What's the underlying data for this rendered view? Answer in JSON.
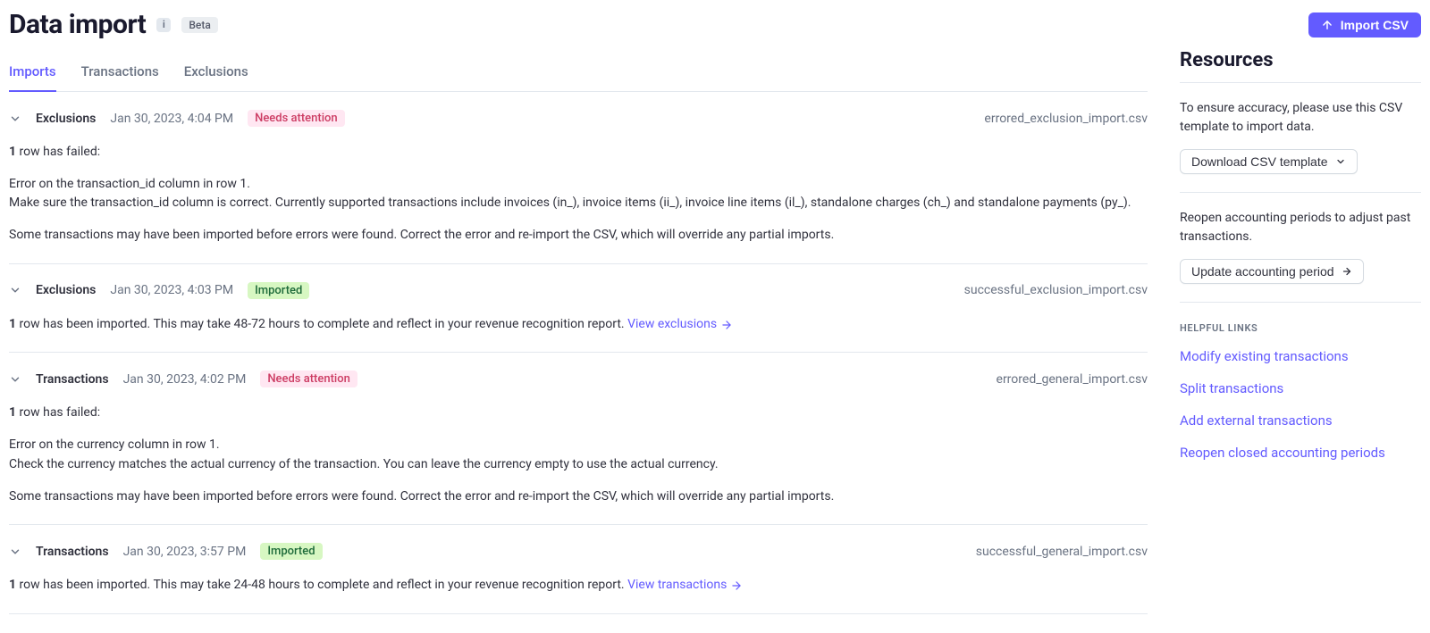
{
  "header": {
    "title": "Data import",
    "beta_label": "Beta",
    "import_button": "Import CSV"
  },
  "tabs": [
    {
      "label": "Imports",
      "active": true
    },
    {
      "label": "Transactions",
      "active": false
    },
    {
      "label": "Exclusions",
      "active": false
    }
  ],
  "imports": [
    {
      "type": "Exclusions",
      "date": "Jan 30, 2023, 4:04 PM",
      "status_label": "Needs attention",
      "status_kind": "error",
      "file": "errored_exclusion_import.csv",
      "summary_prefix": "1",
      "summary_rest": " row has failed:",
      "body_lines": [
        "Error on the transaction_id column in row 1.",
        "Make sure the transaction_id column is correct. Currently supported transactions include invoices (in_), invoice items (ii_), invoice line items (il_), standalone charges (ch_) and standalone payments (py_)."
      ],
      "footer": "Some transactions may have been imported before errors were found. Correct the error and re-import the CSV, which will override any partial imports."
    },
    {
      "type": "Exclusions",
      "date": "Jan 30, 2023, 4:03 PM",
      "status_label": "Imported",
      "status_kind": "ok",
      "file": "successful_exclusion_import.csv",
      "single_line_prefix": "1",
      "single_line_rest": " row has been imported. This may take 48-72 hours to complete and reflect in your revenue recognition report. ",
      "link_label": "View exclusions"
    },
    {
      "type": "Transactions",
      "date": "Jan 30, 2023, 4:02 PM",
      "status_label": "Needs attention",
      "status_kind": "error",
      "file": "errored_general_import.csv",
      "summary_prefix": "1",
      "summary_rest": " row has failed:",
      "body_lines": [
        "Error on the currency column in row 1.",
        "Check the currency matches the actual currency of the transaction. You can leave the currency empty to use the actual currency."
      ],
      "footer": "Some transactions may have been imported before errors were found. Correct the error and re-import the CSV, which will override any partial imports."
    },
    {
      "type": "Transactions",
      "date": "Jan 30, 2023, 3:57 PM",
      "status_label": "Imported",
      "status_kind": "ok",
      "file": "successful_general_import.csv",
      "single_line_prefix": "1",
      "single_line_rest": " row has been imported. This may take 24-48 hours to complete and reflect in your revenue recognition report. ",
      "link_label": "View transactions"
    }
  ],
  "resources": {
    "title": "Resources",
    "intro": "To ensure accuracy, please use this CSV template to import data.",
    "download_button": "Download CSV template",
    "reopen_text": "Reopen accounting periods to adjust past transactions.",
    "update_button": "Update accounting period",
    "links_heading": "HELPFUL LINKS",
    "links": [
      "Modify existing transactions",
      "Split transactions",
      "Add external transactions",
      "Reopen closed accounting periods"
    ]
  }
}
